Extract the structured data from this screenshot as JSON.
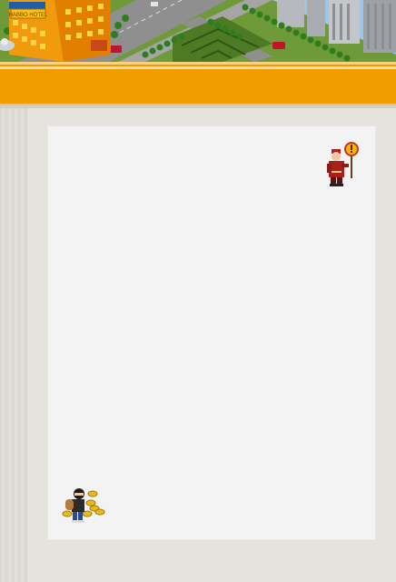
{
  "banner": {
    "hotel_sign_text": "HABBO HOTEL",
    "sky_color": "#9cc7e8",
    "grass_color": "#6f9a3a",
    "road_color": "#8f8f8f",
    "building_color": "#f19a0c"
  },
  "header_bar": {
    "color": "#f39c00"
  },
  "content": {
    "background_color": "#f3f3f3",
    "sprites": [
      "hotel-guard-with-warning-sign",
      "thief-with-gold-coins"
    ]
  }
}
